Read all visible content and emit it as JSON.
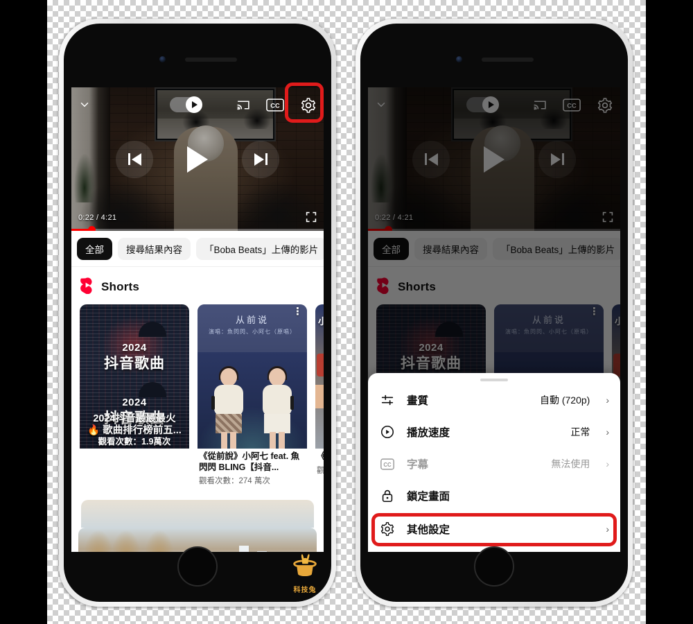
{
  "meta": {
    "scene": "YouTube mobile app video player settings — before/after on two iPhones",
    "accent_red": "#e01b1b",
    "yt_red": "#ff0000"
  },
  "watermark": {
    "name": "rabbit-in-hat-logo",
    "text": "科技兔",
    "color": "#e8a83a"
  },
  "phones": [
    {
      "id": "left",
      "label": "phone-before",
      "player": {
        "time_current": "0:22",
        "time_total": "4:21",
        "timecode": "0:22 / 4:21",
        "progress_percent": 8,
        "controls": {
          "collapse": "chevron-down-icon",
          "autoplay_toggle": "autoplay-toggle",
          "autoplay_on": true,
          "cast": "cast-icon",
          "captions": "CC",
          "settings": "gear-icon",
          "previous": "previous-icon",
          "play": "play-icon",
          "next": "next-icon",
          "fullscreen": "fullscreen-icon"
        }
      },
      "chips": [
        {
          "label": "全部",
          "active": true
        },
        {
          "label": "搜尋結果內容",
          "active": false
        },
        {
          "label": "「Boba Beats」上傳的影片",
          "active": false
        }
      ],
      "shorts": {
        "section_label": "Shorts",
        "cards": [
          {
            "overlay_year": "2024",
            "overlay_text": "抖音歌曲",
            "caption_line1": "2024抖音最最最火",
            "caption_line2": "🔥 歌曲排行榜前五...",
            "caption_line3": "觀看次數：1.9萬次",
            "title": "2024抖音最最最火歌曲排行榜前五...",
            "views": "觀看次數：1.9萬次"
          },
          {
            "thumb_title": "从前说",
            "thumb_sub": "演唱：魚閃閃、小阿七（原唱）",
            "title": "《從前說》小阿七 feat. 魚閃閃 BLING【抖音...",
            "views": "觀看次數：274 萬次"
          },
          {
            "overlay_text": "小阿",
            "title": "《唱",
            "views": "觀"
          }
        ]
      },
      "highlight": {
        "target": "settings-gear-button"
      }
    },
    {
      "id": "right",
      "label": "phone-after",
      "dimmed": true,
      "player": {
        "timecode": "0:22 / 4:21",
        "progress_percent": 8
      },
      "chips": [
        {
          "label": "全部",
          "active": true
        },
        {
          "label": "搜尋結果內容",
          "active": false
        },
        {
          "label": "「Boba Beats」上傳的影片",
          "active": false
        }
      ],
      "shorts": {
        "section_label": "Shorts"
      },
      "settings_sheet": {
        "rows": [
          {
            "icon": "quality-sliders-icon",
            "label": "畫質",
            "value": "自動 (720p)",
            "chevron": "›",
            "disabled": false,
            "highlight": false
          },
          {
            "icon": "playback-speed-icon",
            "label": "播放速度",
            "value": "正常",
            "chevron": "›",
            "disabled": false,
            "highlight": false
          },
          {
            "icon": "closed-captions-icon",
            "label": "字幕",
            "value": "無法使用",
            "chevron": "›",
            "disabled": true,
            "highlight": false
          },
          {
            "icon": "lock-screen-icon",
            "label": "鎖定畫面",
            "value": "",
            "chevron": "",
            "disabled": false,
            "highlight": false
          },
          {
            "icon": "gear-icon",
            "label": "其他設定",
            "value": "",
            "chevron": "›",
            "disabled": false,
            "highlight": true
          }
        ]
      },
      "highlight": {
        "target": "additional-settings-row"
      }
    }
  ]
}
